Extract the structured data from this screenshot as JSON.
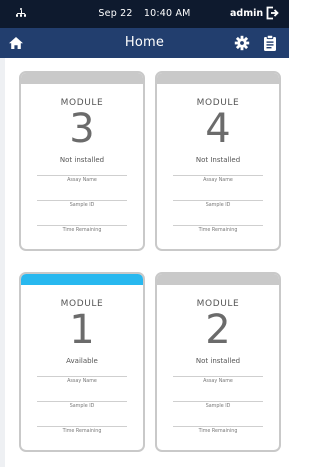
{
  "status_bar": {
    "date": "Sep 22",
    "time": "10:40 AM",
    "user": "admin"
  },
  "nav": {
    "title": "Home"
  },
  "icons": {
    "network": "network-icon",
    "logout": "logout-icon",
    "home": "home-icon",
    "settings": "gear-icon",
    "report": "clipboard-icon"
  },
  "colors": {
    "status_bar_bg": "#0e1a2e",
    "nav_bg": "#223e6e",
    "card_header_inactive": "#c9c9c9",
    "card_header_active": "#28b8ef"
  },
  "modules": [
    {
      "caption": "MODULE",
      "number": "3",
      "status": "Not installed",
      "active": false,
      "fields": [
        "Assay Name",
        "Sample ID",
        "Time Remaining"
      ]
    },
    {
      "caption": "MODULE",
      "number": "4",
      "status": "Not Installed",
      "active": false,
      "fields": [
        "Assay Name",
        "Sample ID",
        "Time Remaining"
      ]
    },
    {
      "caption": "MODULE",
      "number": "1",
      "status": "Available",
      "active": true,
      "fields": [
        "Assay Name",
        "Sample ID",
        "Time Remaining"
      ]
    },
    {
      "caption": "MODULE",
      "number": "2",
      "status": "Not installed",
      "active": false,
      "fields": [
        "Assay Name",
        "Sample ID",
        "Time Remaining"
      ]
    }
  ]
}
